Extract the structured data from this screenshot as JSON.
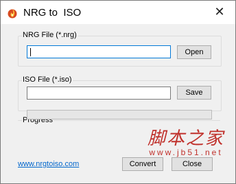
{
  "window": {
    "title": "NRG to  ISO",
    "close_glyph": "✕",
    "icon": "flame-icon"
  },
  "nrg_group": {
    "label": "NRG File (*.nrg)",
    "input_value": "",
    "button_label": "Open"
  },
  "iso_group": {
    "label": "ISO File (*.iso)",
    "input_value": "",
    "button_label": "Save"
  },
  "progress_group": {
    "label": "Progress",
    "value": 0
  },
  "footer": {
    "link_text": "www.nrgtoiso.com",
    "convert_label": "Convert",
    "close_label": "Close"
  },
  "watermark": {
    "text": "脚本之家",
    "url": "www.jb51.net"
  },
  "colors": {
    "accent": "#0078d7",
    "link": "#0066cc",
    "watermark": "#c0312c"
  }
}
